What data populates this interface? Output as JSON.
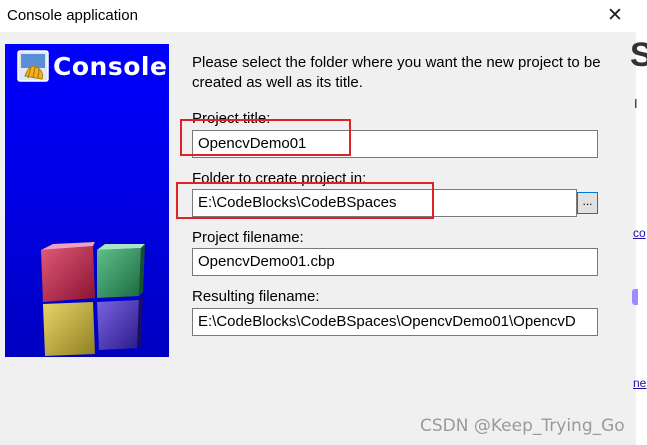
{
  "window": {
    "title": "Console application",
    "close_glyph": "✕"
  },
  "banner": {
    "title": "Console",
    "icon": "codeblocks-shell-icon",
    "art": "codeblocks-cube-logo"
  },
  "form": {
    "intro": "Please select the folder where you want the new project to be created as well as its title.",
    "project_title_label": "Project title:",
    "project_title_value": "OpencvDemo01",
    "folder_label": "Folder to create project in:",
    "folder_value": "E:\\CodeBlocks\\CodeBSpaces",
    "browse_label": "...",
    "project_filename_label": "Project filename:",
    "project_filename_value": "OpencvDemo01.cbp",
    "resulting_filename_label": "Resulting filename:",
    "resulting_filename_value": "E:\\CodeBlocks\\CodeBSpaces\\OpencvDemo01\\OpencvD"
  },
  "annotations": {
    "highlight_color": "#e0202a"
  },
  "background_page": {
    "big_letter": "S",
    "dot": "I",
    "link1": "co",
    "link2": "ne"
  },
  "watermark": "CSDN @Keep_Trying_Go"
}
